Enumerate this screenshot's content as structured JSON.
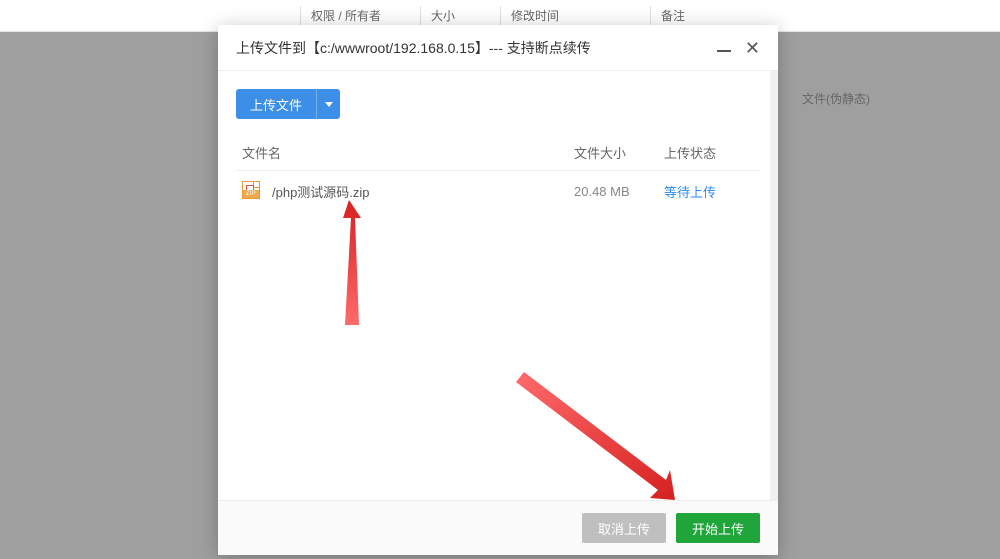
{
  "bg": {
    "columns": [
      "权限 / 所有者",
      "大小",
      "修改时间",
      "备注"
    ],
    "note_partial": "文件(伪静态)"
  },
  "modal": {
    "title": "上传文件到【c:/wwwroot/192.168.0.15】--- 支持断点续传",
    "upload_button": "上传文件",
    "table": {
      "header_name": "文件名",
      "header_size": "文件大小",
      "header_status": "上传状态"
    },
    "files": [
      {
        "name": "/php测试源码.zip",
        "size": "20.48 MB",
        "status": "等待上传",
        "icon_band": "ZIP"
      }
    ],
    "footer": {
      "cancel": "取消上传",
      "start": "开始上传"
    }
  }
}
